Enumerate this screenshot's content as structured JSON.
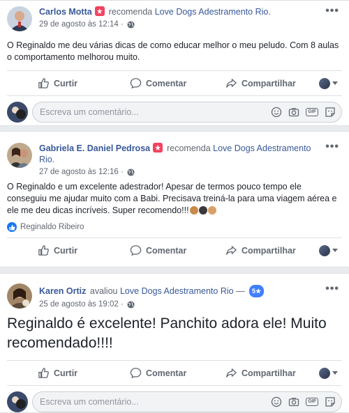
{
  "posts": [
    {
      "author": "Carlos Motta",
      "verb": "recomenda",
      "page": "Love Dogs Adestramento Rio.",
      "date": "29 de agosto às 12:14 ·",
      "text": "O Reginaldo me deu várias dicas de como educar melhor o meu peludo. Com 8 aulas o comportamento melhorou muito."
    },
    {
      "author": "Gabriela E. Daniel Pedrosa",
      "verb": "recomenda",
      "page": "Love Dogs Adestramento Rio.",
      "date": "27 de agosto às 12:16 ·",
      "text": "O Reginaldo e um excelente adestrador! Apesar de termos pouco tempo ele conseguiu me ajudar muito com a Babi. Precisava treiná-la para uma viagem aérea e ele me deu dicas incríveis. Super recomendo!!!",
      "reaction_name": "Reginaldo Ribeiro"
    },
    {
      "author": "Karen Ortiz",
      "verb": "avaliou",
      "page": "Love Dogs Adestramento Rio",
      "separator": "—",
      "rating": "5★",
      "date": "25 de agosto às 19:02 ·",
      "text": "Reginaldo é excelente! Panchito adora ele! Muito recomendado!!!!"
    }
  ],
  "actions": {
    "like": "Curtir",
    "comment": "Comentar",
    "share": "Compartilhar"
  },
  "comment_placeholder": "Escreva um comentário...",
  "icons": {
    "more": "more-options-icon",
    "globe": "globe-icon",
    "like": "thumbs-up-icon",
    "comment": "speech-bubble-icon",
    "share": "share-arrow-icon",
    "emoji": "smiley-icon",
    "camera": "camera-icon",
    "gif": "GIF",
    "sticker": "sticker-icon"
  },
  "colors": {
    "link": "#385898",
    "meta": "#606770",
    "background": "#e9ebee",
    "rating_badge": "#4080ff",
    "recommend_flag": "#f3425f"
  }
}
